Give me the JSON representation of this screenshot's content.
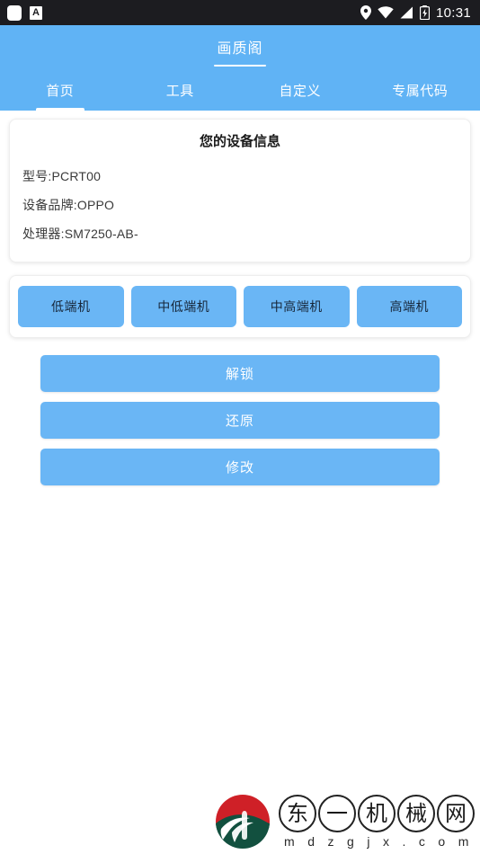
{
  "statusbar": {
    "notification_icon": "notification-square-icon",
    "ime_icon_label": "A",
    "location_icon": "location-pin-icon",
    "wifi_icon": "wifi-icon",
    "signal_icon": "signal-bars-icon",
    "battery_icon": "battery-charging-icon",
    "time": "10:31",
    "background_color": "#1c1c20"
  },
  "appbar": {
    "title": "画质阁",
    "background_color": "#60b3f5"
  },
  "tabs": [
    {
      "label": "首页",
      "active": true
    },
    {
      "label": "工具",
      "active": false
    },
    {
      "label": "自定义",
      "active": false
    },
    {
      "label": "专属代码",
      "active": false
    }
  ],
  "device_card": {
    "title": "您的设备信息",
    "rows": [
      "型号:PCRT00",
      "设备品牌:OPPO",
      "处理器:SM7250-AB-"
    ]
  },
  "tier_buttons": [
    {
      "label": "低端机"
    },
    {
      "label": "中低端机"
    },
    {
      "label": "中高端机"
    },
    {
      "label": "高端机"
    }
  ],
  "action_buttons": [
    {
      "label": "解锁"
    },
    {
      "label": "还原"
    },
    {
      "label": "修改"
    }
  ],
  "watermark": {
    "logo_icon": "dongyi-logo-icon",
    "chars": [
      "东",
      "一",
      "机",
      "械",
      "网"
    ],
    "url_letters": [
      "m",
      "d",
      "z",
      "g",
      "j",
      "x",
      ".",
      "c",
      "o",
      "m"
    ],
    "url": "mdzgjx.com"
  },
  "colors": {
    "accent_blue": "#60b3f5",
    "button_blue": "#6ab6f5",
    "statusbar": "#1c1c20",
    "page_bg": "#ffffff",
    "logo_red": "#cf2027",
    "logo_green": "#12503f"
  }
}
